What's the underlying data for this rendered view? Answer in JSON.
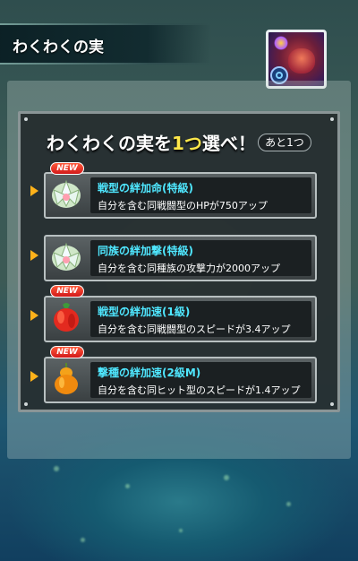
{
  "header": {
    "title": "わくわくの実"
  },
  "dialog": {
    "prompt_pre": "わくわくの実を",
    "prompt_accent": "1つ",
    "prompt_post": "選べ！",
    "remaining": "あと1つ"
  },
  "options": [
    {
      "badge": "NEW",
      "name": "戦型の絆加命(特級)",
      "desc": "自分を含む同戦闘型のHPが750アップ",
      "fruit_icon": "white-lotus-fruit-icon"
    },
    {
      "badge": "",
      "name": "同族の絆加撃(特級)",
      "desc": "自分を含む同種族の攻撃力が2000アップ",
      "fruit_icon": "white-lotus-fruit-icon"
    },
    {
      "badge": "NEW",
      "name": "戦型の絆加速(1級)",
      "desc": "自分を含む同戦闘型のスピードが3.4アップ",
      "fruit_icon": "red-pepper-fruit-icon"
    },
    {
      "badge": "NEW",
      "name": "撃種の絆加速(2級M)",
      "desc": "自分を含む同ヒット型のスピードが1.4アップ",
      "fruit_icon": "orange-gourd-fruit-icon"
    }
  ],
  "colors": {
    "name_text": "#4fe7ff",
    "accent_text": "#ffe84a",
    "arrow": "#ffb21a",
    "new_badge": "#e0301f"
  }
}
